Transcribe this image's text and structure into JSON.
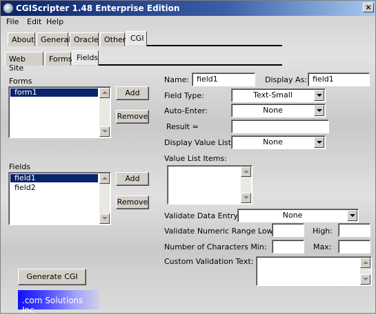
{
  "window": {
    "title": "CGIScripter 1.48 Enterprise Edition",
    "close": "×"
  },
  "menu": [
    "File",
    "Edit",
    "Help"
  ],
  "tabs_top": [
    "About",
    "General",
    "Oracle",
    "Other",
    "CGI"
  ],
  "tabs_sub": [
    "Web Site",
    "Forms",
    "Fields"
  ],
  "forms": {
    "label": "Forms",
    "items": [
      "form1"
    ],
    "add": "Add",
    "remove": "Remove"
  },
  "fields": {
    "label": "Fields",
    "items": [
      "field1",
      "field2"
    ],
    "add": "Add",
    "remove": "Remove"
  },
  "props": {
    "name_label": "Name:",
    "name_value": "field1",
    "display_as_label": "Display As:",
    "display_as_value": "field1",
    "field_type_label": "Field Type:",
    "field_type_value": "Text-Small",
    "auto_enter_label": "Auto-Enter:",
    "auto_enter_value": "None",
    "result_label": "Result =",
    "result_value": "",
    "display_value_list_label": "Display Value List:",
    "display_value_list_value": "None",
    "value_list_items_label": "Value List Items:",
    "validate_data_entry_label": "Validate Data Entry:",
    "validate_data_entry_value": "None",
    "validate_numeric_low_label": "Validate Numeric Range Low:",
    "high_label": "High:",
    "num_chars_min_label": "Number of Characters Min:",
    "max_label": "Max:",
    "custom_validation_label": "Custom Validation Text:"
  },
  "generate_button": "Generate CGI",
  "logo_text": ".com Solutions Inc."
}
